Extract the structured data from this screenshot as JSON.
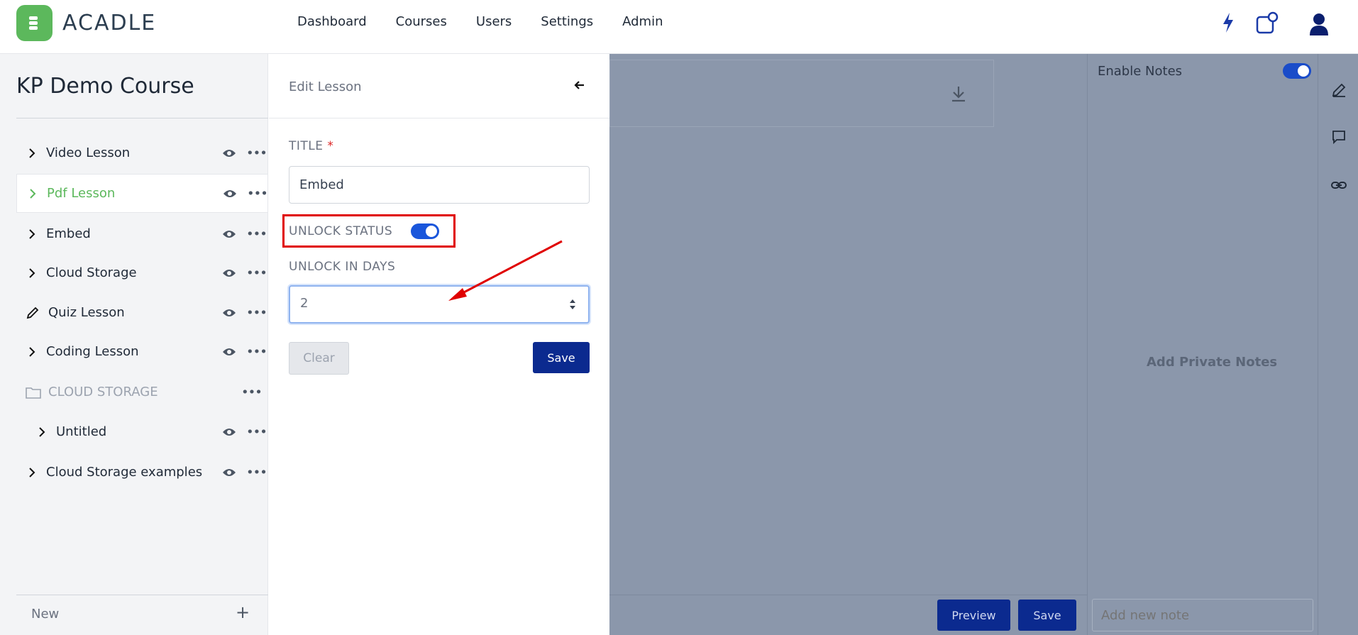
{
  "app": {
    "logo_text": "ACADLE",
    "brand_color": "#5cb85c",
    "primary_color": "#0b2a8f"
  },
  "nav": {
    "items": [
      "Dashboard",
      "Courses",
      "Users",
      "Settings",
      "Admin"
    ]
  },
  "top_icons": [
    "lightning-icon",
    "notifications-icon",
    "user-avatar-icon"
  ],
  "sidebar": {
    "course_title": "KP Demo Course",
    "items": [
      {
        "label": "Video Lesson",
        "icon": "chevron-right-icon",
        "active": false
      },
      {
        "label": "Pdf Lesson",
        "icon": "chevron-right-icon",
        "active": true
      },
      {
        "label": "Embed",
        "icon": "chevron-right-icon",
        "active": false
      },
      {
        "label": "Cloud Storage",
        "icon": "chevron-right-icon",
        "active": false
      },
      {
        "label": "Quiz Lesson",
        "icon": "pencil-icon",
        "active": false
      },
      {
        "label": "Coding Lesson",
        "icon": "chevron-right-icon",
        "active": false
      },
      {
        "label": "CLOUD STORAGE",
        "icon": "folder-icon",
        "active": false
      },
      {
        "label": "Untitled",
        "icon": "chevron-right-icon",
        "active": false
      },
      {
        "label": "Cloud Storage examples",
        "icon": "chevron-right-icon",
        "active": false
      }
    ],
    "new_label": "New"
  },
  "edit_panel": {
    "title": "Edit Lesson",
    "title_label": "TITLE",
    "required_mark": "*",
    "title_value": "Embed",
    "unlock_status_label": "UNLOCK STATUS",
    "unlock_status_on": true,
    "unlock_days_label": "UNLOCK IN DAYS",
    "unlock_days_value": "2",
    "clear_label": "Clear",
    "save_label": "Save"
  },
  "main": {
    "enable_notes_label": "Enable Notes",
    "enable_notes_on": true,
    "add_private_notes": "Add Private Notes",
    "note_placeholder": "Add new note",
    "preview_label": "Preview",
    "save_label": "Save"
  },
  "annotation": {
    "highlight_color": "#e00000"
  }
}
